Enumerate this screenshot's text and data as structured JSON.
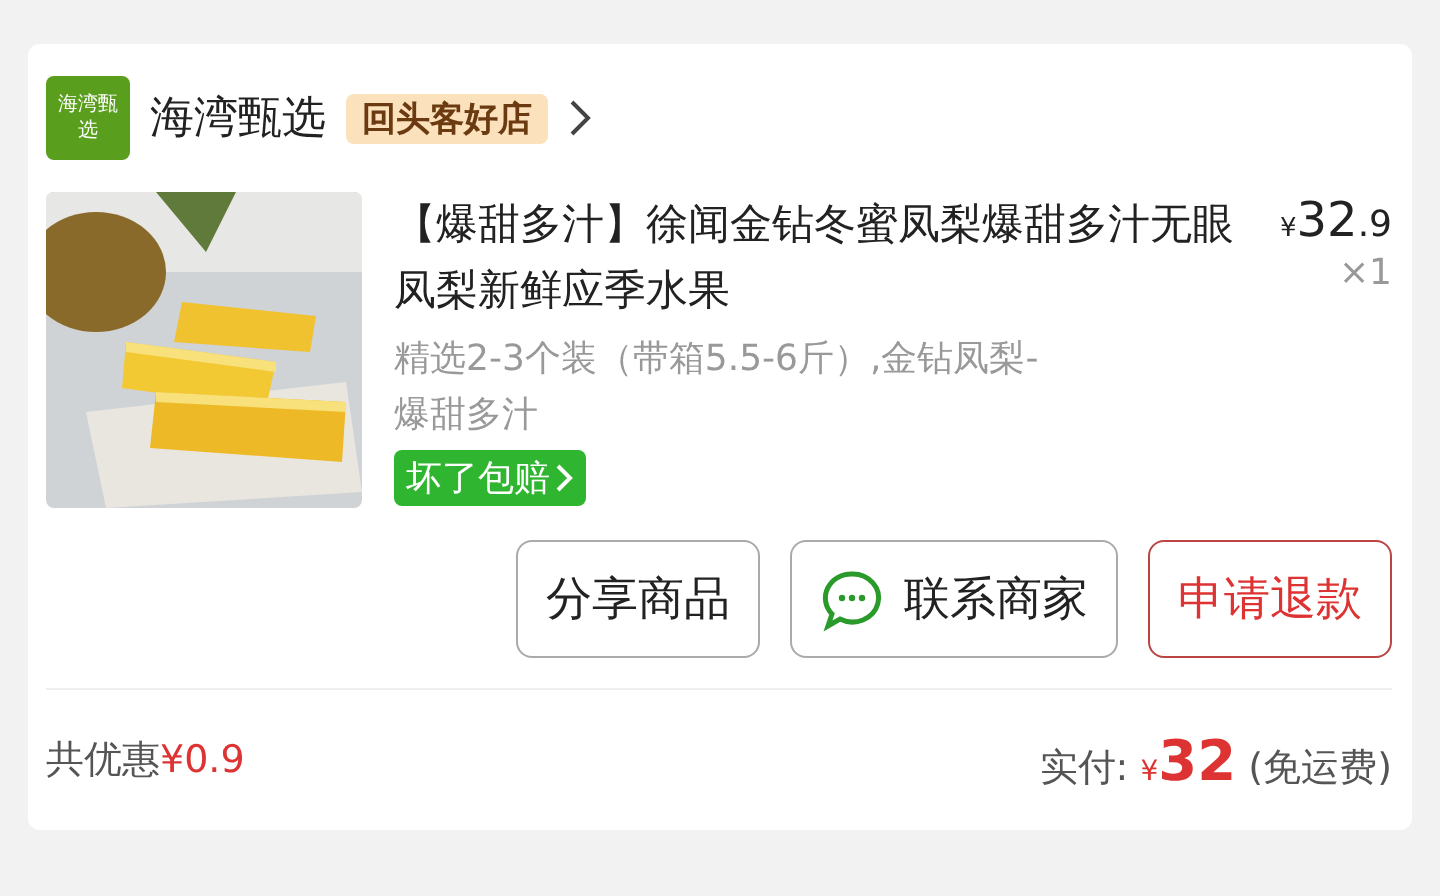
{
  "shop": {
    "logo": "海湾甄选",
    "name": "海湾甄选",
    "badge": "回头客好店"
  },
  "product": {
    "kind": "picture",
    "title": "【爆甜多汁】徐闻金钻冬蜜凤梨爆甜多汁无眼凤梨新鲜应季水果",
    "price": {
      "currency": "¥",
      "integer": "32",
      "fraction": ".9"
    },
    "quantity": "×1",
    "spec": "精选2-3个装（带箱5.5-6斤）,金钻凤梨-爆甜多汁",
    "guarantee": "坏了包赔"
  },
  "buttons": [
    {
      "label": "分享商品",
      "kind": "plain"
    },
    {
      "label": "联系商家",
      "kind": "chat"
    },
    {
      "label": "申请退款",
      "kind": "danger"
    }
  ],
  "summary": {
    "discount_label": "共优惠",
    "discount": "¥0.9",
    "paid_label": "实付:",
    "currency": "¥",
    "paid": "32",
    "shipping": "(免运费)"
  }
}
